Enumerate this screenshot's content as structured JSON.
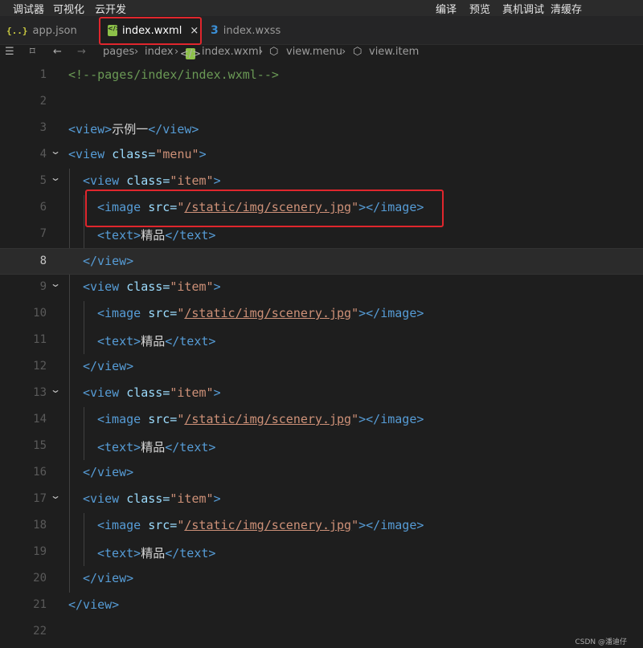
{
  "menu": {
    "left": [
      "调试器",
      "可视化",
      "云开发"
    ],
    "right": [
      "编译",
      "预览",
      "真机调试",
      "清缓存"
    ]
  },
  "tabs": [
    {
      "icon": "{..}",
      "label": "app.json",
      "active": false
    },
    {
      "icon": "wxml-file-icon",
      "label": "index.wxml",
      "active": true,
      "close": "×"
    },
    {
      "icon": "wxss-file-icon",
      "label": "index.wxss",
      "active": false
    }
  ],
  "breadcrumb": [
    "pages",
    "index",
    "index.wxml",
    "view.menu",
    "view.item"
  ],
  "editor": {
    "current_line": 8,
    "lines": [
      {
        "n": "1",
        "parts": [
          {
            "t": "<!--pages/index/index.wxml-->",
            "c": "com"
          }
        ]
      },
      {
        "n": "2",
        "parts": []
      },
      {
        "n": "3",
        "parts": [
          {
            "t": "<view>",
            "c": "tag"
          },
          {
            "t": "示例一",
            "c": "txt"
          },
          {
            "t": "</view>",
            "c": "tag"
          }
        ]
      },
      {
        "n": "4",
        "parts": [
          {
            "t": "<view ",
            "c": "tag"
          },
          {
            "t": "class=",
            "c": "attr"
          },
          {
            "t": "\"menu\"",
            "c": "str"
          },
          {
            "t": ">",
            "c": "tag"
          }
        ]
      },
      {
        "n": "5",
        "parts": [
          {
            "t": "<view ",
            "c": "tag"
          },
          {
            "t": "class=",
            "c": "attr"
          },
          {
            "t": "\"item\"",
            "c": "str"
          },
          {
            "t": ">",
            "c": "tag"
          }
        ]
      },
      {
        "n": "6",
        "parts": [
          {
            "t": "<image ",
            "c": "tag"
          },
          {
            "t": "src=",
            "c": "attr"
          },
          {
            "t": "\"",
            "c": "str"
          },
          {
            "t": "/static/img/scenery.jpg",
            "c": "url"
          },
          {
            "t": "\"",
            "c": "str"
          },
          {
            "t": "></image>",
            "c": "tag"
          }
        ]
      },
      {
        "n": "7",
        "parts": [
          {
            "t": "<text>",
            "c": "tag"
          },
          {
            "t": "精品",
            "c": "txt"
          },
          {
            "t": "</text>",
            "c": "tag"
          }
        ]
      },
      {
        "n": "8",
        "parts": [
          {
            "t": "</view>",
            "c": "tag"
          }
        ]
      },
      {
        "n": "9",
        "parts": [
          {
            "t": "<view ",
            "c": "tag"
          },
          {
            "t": "class=",
            "c": "attr"
          },
          {
            "t": "\"item\"",
            "c": "str"
          },
          {
            "t": ">",
            "c": "tag"
          }
        ]
      },
      {
        "n": "10",
        "parts": [
          {
            "t": "<image ",
            "c": "tag"
          },
          {
            "t": "src=",
            "c": "attr"
          },
          {
            "t": "\"",
            "c": "str"
          },
          {
            "t": "/static/img/scenery.jpg",
            "c": "url"
          },
          {
            "t": "\"",
            "c": "str"
          },
          {
            "t": "></image>",
            "c": "tag"
          }
        ]
      },
      {
        "n": "11",
        "parts": [
          {
            "t": "<text>",
            "c": "tag"
          },
          {
            "t": "精品",
            "c": "txt"
          },
          {
            "t": "</text>",
            "c": "tag"
          }
        ]
      },
      {
        "n": "12",
        "parts": [
          {
            "t": "</view>",
            "c": "tag"
          }
        ]
      },
      {
        "n": "13",
        "parts": [
          {
            "t": "<view ",
            "c": "tag"
          },
          {
            "t": "class=",
            "c": "attr"
          },
          {
            "t": "\"item\"",
            "c": "str"
          },
          {
            "t": ">",
            "c": "tag"
          }
        ]
      },
      {
        "n": "14",
        "parts": [
          {
            "t": "<image ",
            "c": "tag"
          },
          {
            "t": "src=",
            "c": "attr"
          },
          {
            "t": "\"",
            "c": "str"
          },
          {
            "t": "/static/img/scenery.jpg",
            "c": "url"
          },
          {
            "t": "\"",
            "c": "str"
          },
          {
            "t": "></image>",
            "c": "tag"
          }
        ]
      },
      {
        "n": "15",
        "parts": [
          {
            "t": "<text>",
            "c": "tag"
          },
          {
            "t": "精品",
            "c": "txt"
          },
          {
            "t": "</text>",
            "c": "tag"
          }
        ]
      },
      {
        "n": "16",
        "parts": [
          {
            "t": "</view>",
            "c": "tag"
          }
        ]
      },
      {
        "n": "17",
        "parts": [
          {
            "t": "<view ",
            "c": "tag"
          },
          {
            "t": "class=",
            "c": "attr"
          },
          {
            "t": "\"item\"",
            "c": "str"
          },
          {
            "t": ">",
            "c": "tag"
          }
        ]
      },
      {
        "n": "18",
        "parts": [
          {
            "t": "<image ",
            "c": "tag"
          },
          {
            "t": "src=",
            "c": "attr"
          },
          {
            "t": "\"",
            "c": "str"
          },
          {
            "t": "/static/img/scenery.jpg",
            "c": "url"
          },
          {
            "t": "\"",
            "c": "str"
          },
          {
            "t": "></image>",
            "c": "tag"
          }
        ]
      },
      {
        "n": "19",
        "parts": [
          {
            "t": "<text>",
            "c": "tag"
          },
          {
            "t": "精品",
            "c": "txt"
          },
          {
            "t": "</text>",
            "c": "tag"
          }
        ]
      },
      {
        "n": "20",
        "parts": [
          {
            "t": "</view>",
            "c": "tag"
          }
        ]
      },
      {
        "n": "21",
        "parts": [
          {
            "t": "</view>",
            "c": "tag"
          }
        ]
      },
      {
        "n": "22",
        "parts": []
      }
    ]
  },
  "watermark": "CSDN @潘迪仔",
  "colors": {
    "background": "#1e1e1e",
    "tag": "#569cd6",
    "attribute": "#9cdcfe",
    "string": "#ce9178",
    "comment": "#6a9955",
    "highlight_box": "#e0262d"
  }
}
